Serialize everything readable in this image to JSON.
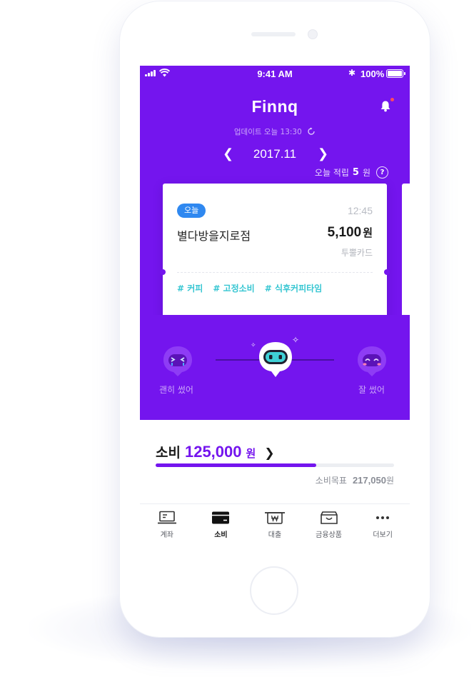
{
  "status_bar": {
    "time": "9:41 AM",
    "battery": "100%"
  },
  "header": {
    "title": "Finnq",
    "updated": "업데이트 오늘 13:30",
    "month": "2017.11",
    "earn_label": "오늘 적립",
    "earn_value": "5",
    "earn_unit": "원",
    "help_glyph": "?"
  },
  "transaction": {
    "badge": "오늘",
    "time": "12:45",
    "merchant": "별다방을지로점",
    "amount": "5,100",
    "currency": "원",
    "card": "투뿔카드",
    "tags": [
      "# 커피",
      "# 고정소비",
      "# 식후커피타임"
    ]
  },
  "mood": {
    "left_label": "괜히 썼어",
    "right_label": "잘 썼어"
  },
  "spending": {
    "label": "소비",
    "value": "125,000",
    "unit": "원",
    "progress": 0.675,
    "goal_label": "소비목표",
    "goal_value": "217,050",
    "goal_unit": "원"
  },
  "tabs": [
    {
      "label": "계좌",
      "icon": "laptop-icon",
      "active": false
    },
    {
      "label": "소비",
      "icon": "card-icon",
      "active": true
    },
    {
      "label": "대출",
      "icon": "loan-icon",
      "active": false
    },
    {
      "label": "금융상품",
      "icon": "bag-icon",
      "active": false
    },
    {
      "label": "더보기",
      "icon": "more-icon",
      "active": false
    }
  ],
  "colors": {
    "brand": "#7415ee",
    "badge": "#2f88f0",
    "tag": "#36c6d2",
    "face": "#8e3cf5",
    "robot": "#3fd0d6"
  }
}
